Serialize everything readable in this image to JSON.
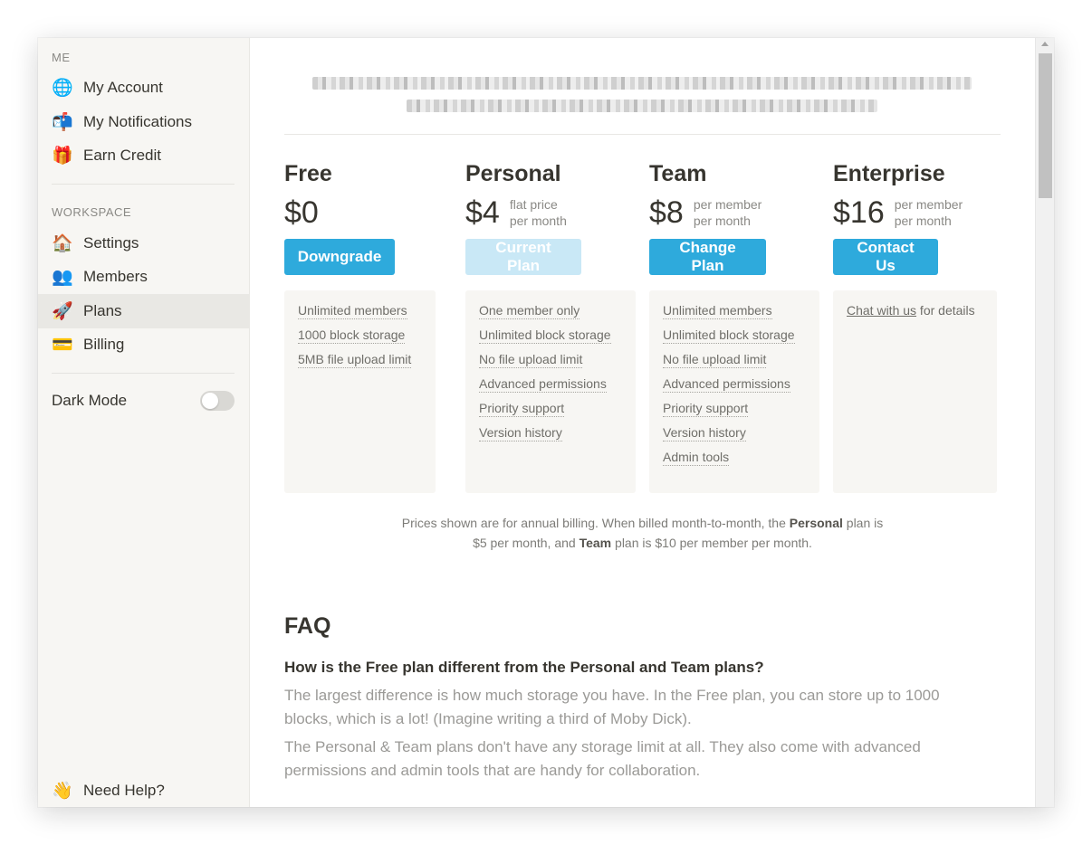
{
  "sidebar": {
    "me_label": "ME",
    "me_items": [
      {
        "label": "My Account",
        "icon": "globe-avatar-icon",
        "glyph": "🌐"
      },
      {
        "label": "My Notifications",
        "icon": "mailbox-icon",
        "glyph": "📬"
      },
      {
        "label": "Earn Credit",
        "icon": "gift-icon",
        "glyph": "🎁"
      }
    ],
    "workspace_label": "WORKSPACE",
    "workspace_items": [
      {
        "label": "Settings",
        "icon": "house-icon",
        "glyph": "🏠"
      },
      {
        "label": "Members",
        "icon": "members-icon",
        "glyph": "👥"
      },
      {
        "label": "Plans",
        "icon": "rocket-icon",
        "glyph": "🚀"
      },
      {
        "label": "Billing",
        "icon": "credit-card-icon",
        "glyph": "💳"
      }
    ],
    "active_item": "Plans",
    "dark_mode_label": "Dark Mode",
    "dark_mode_on": false,
    "help_label": "Need Help?",
    "help_icon": "waving-hand-icon",
    "help_glyph": "👋"
  },
  "plans": [
    {
      "name": "Free",
      "price": "$0",
      "note_line1": "",
      "note_line2": "",
      "button": "Downgrade",
      "current": false,
      "features": [
        "Unlimited members",
        "1000 block storage",
        "5MB file upload limit"
      ]
    },
    {
      "name": "Personal",
      "price": "$4",
      "note_line1": "flat price",
      "note_line2": "per month",
      "button": "Current Plan",
      "current": true,
      "features": [
        "One member only",
        "Unlimited block storage",
        "No file upload limit",
        "Advanced permissions",
        "Priority support",
        "Version history"
      ]
    },
    {
      "name": "Team",
      "price": "$8",
      "note_line1": "per member",
      "note_line2": "per month",
      "button": "Change Plan",
      "current": false,
      "features": [
        "Unlimited members",
        "Unlimited block storage",
        "No file upload limit",
        "Advanced permissions",
        "Priority support",
        "Version history",
        "Admin tools"
      ]
    },
    {
      "name": "Enterprise",
      "price": "$16",
      "note_line1": "per member",
      "note_line2": "per month",
      "button": "Contact Us",
      "current": false,
      "features_link": "Chat with us",
      "features_suffix": " for details"
    }
  ],
  "billing_note": {
    "part1": "Prices shown are for annual billing. When billed month-to-month, the ",
    "personal": "Personal",
    "part2": " plan is",
    "part3": "$5 per month, and ",
    "team": "Team",
    "part4": " plan is $10 per member per month."
  },
  "faq": {
    "title": "FAQ",
    "question": "How is the Free plan different from the Personal and Team plans?",
    "answer1": "The largest difference is how much storage you have. In the Free plan, you can store up to 1000 blocks, which is a lot! (Imagine writing a third of Moby Dick).",
    "answer2": "The Personal & Team plans don't have any storage limit at all. They also come with advanced permissions and admin tools that are handy for collaboration."
  },
  "colors": {
    "accent": "#2eaadc",
    "accent_disabled": "#c9e8f6",
    "sidebar_bg": "#f7f6f3",
    "text": "#37352f"
  }
}
